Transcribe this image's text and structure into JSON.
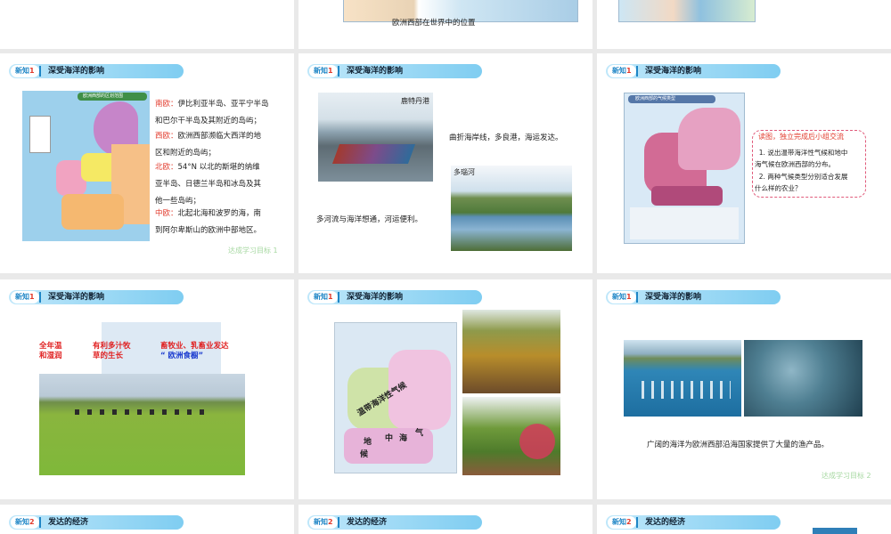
{
  "top_row": {
    "caption_middle": "欧洲西部在世界中的位置"
  },
  "row2": {
    "slide1": {
      "tag_label": "新知",
      "tag_num": "1",
      "title": "深受海洋的影响",
      "map_title": "欧洲西部的区划范围",
      "south_label": "南欧：",
      "south_text_1": "伊比利亚半岛、亚平宁半岛",
      "south_text_2": "和巴尔干半岛及其附近的岛屿；",
      "west_label": "西欧：",
      "west_text_1": "欧洲西部濒临大西洋的地",
      "west_text_2": "区和附近的岛屿；",
      "north_label": "北欧：",
      "north_text_1": "54°N 以北的斯堪的纳维",
      "north_text_2": "亚半岛、日德兰半岛和冰岛及其",
      "north_text_3": "他一些岛屿；",
      "central_label": "中欧：",
      "central_text_1": "北起北海和波罗的海，南",
      "central_text_2": "到阿尔卑斯山的欧洲中部地区。",
      "goal": "达成学习目标 1"
    },
    "slide2": {
      "tag_label": "新知",
      "tag_num": "1",
      "title": "深受海洋的影响",
      "port_label": "鹿特丹港",
      "coast_text": "曲折海岸线，多良港，海运发达。",
      "river_label": "多瑙河",
      "river_text": "多河流与海洋想通，河运便利。"
    },
    "slide3": {
      "tag_label": "新知",
      "tag_num": "1",
      "title": "深受海洋的影响",
      "map_title": "欧洲西部的气候类型",
      "bubble_title": "读图，独立完成后小组交流",
      "q1a": "1. 说出温带海洋性气候和地中",
      "q1b": "海气候在欧洲西部的分布。",
      "q2a": "2. 两种气候类型分别适合发展",
      "q2b": "什么样的农业？"
    }
  },
  "row3": {
    "slide1": {
      "tag_label": "新知",
      "tag_num": "1",
      "title": "深受海洋的影响",
      "label_a1": "全年温",
      "label_a2": "和湿润",
      "label_b1": "有利多汁牧",
      "label_b2": "草的生长",
      "label_c1": "畜牧业、乳畜业发达",
      "label_c2": "“ 欧洲食橱”"
    },
    "slide2": {
      "tag_label": "新知",
      "tag_num": "1",
      "title": "深受海洋的影响",
      "map_oceanic": "温带海洋性气候",
      "map_med_1": "地",
      "map_med_2": "中",
      "map_med_3": "海",
      "map_med_4": "气",
      "map_med_5": "候"
    },
    "slide3": {
      "tag_label": "新知",
      "tag_num": "1",
      "title": "深受海洋的影响",
      "fish_text": "广阔的海洋为欧洲西部沿海国家提供了大量的渔产品。",
      "goal": "达成学习目标 2"
    }
  },
  "row4": {
    "slide1": {
      "tag_label": "新知",
      "tag_num": "2",
      "title": "发达的经济"
    },
    "slide2": {
      "tag_label": "新知",
      "tag_num": "2",
      "title": "发达的经济"
    },
    "slide3": {
      "tag_label": "新知",
      "tag_num": "2",
      "title": "发达的经济"
    }
  },
  "colors": {
    "tag_text": "#1f86c6",
    "accent_red": "#e23c2e",
    "header_blue": "#7fcdf1",
    "goal_green": "#a7d8a2"
  }
}
